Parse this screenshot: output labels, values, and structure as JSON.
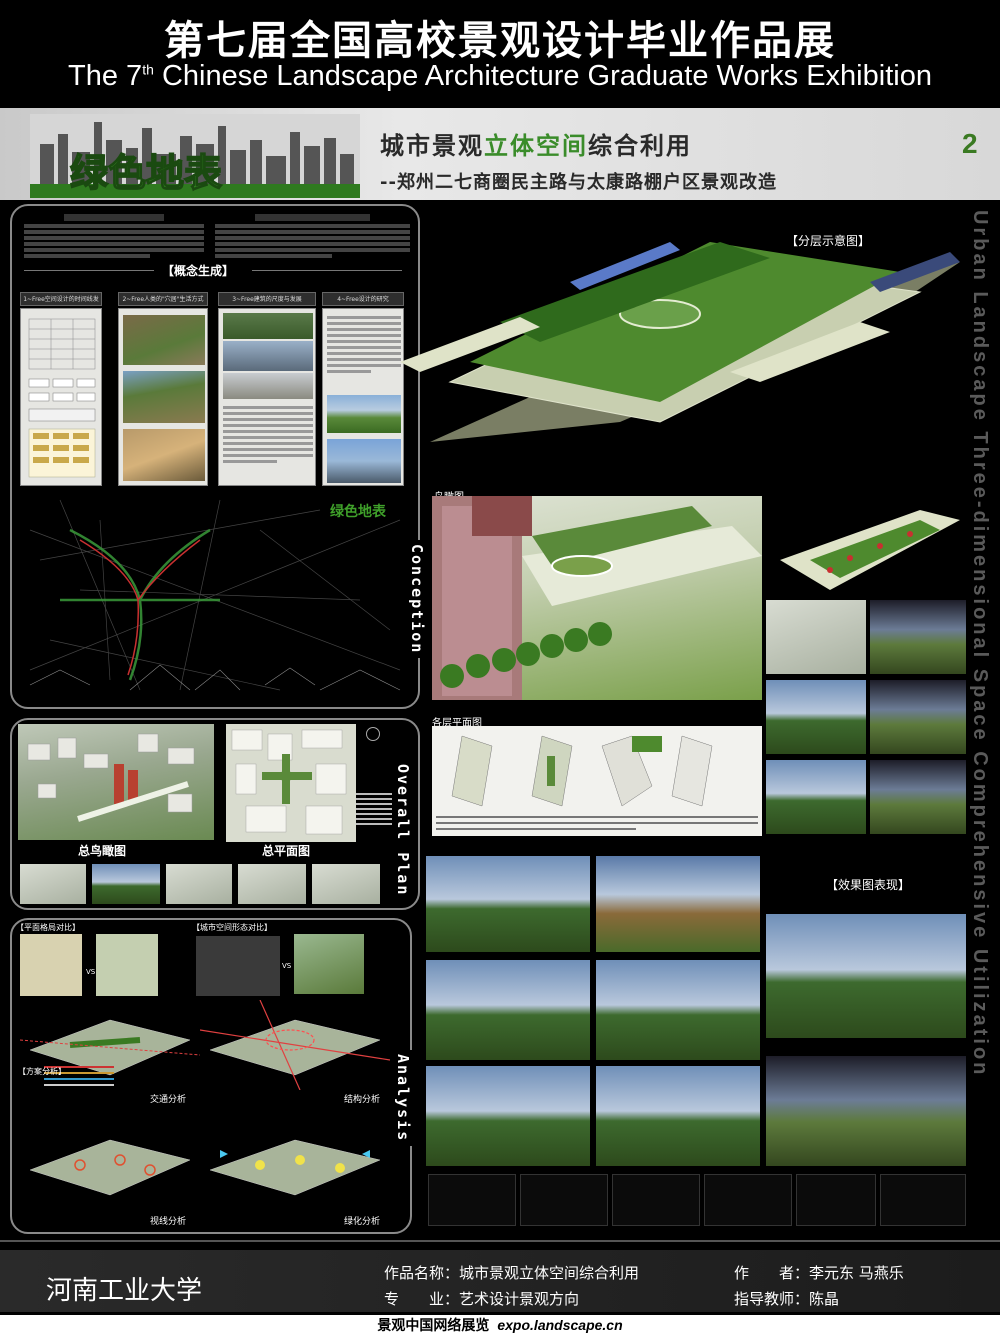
{
  "header": {
    "title_cn": "第七届全国高校景观设计毕业作品展",
    "title_en_pre": "The 7",
    "title_en_sup": "th",
    "title_en_post": " Chinese Landscape Architecture Graduate Works Exhibition"
  },
  "banner": {
    "title_part1": "城市景观",
    "title_part2": "立体空间",
    "title_part3": "综合利用",
    "subtitle": "--郑州二七商圈民主路与太康路棚户区景观改造",
    "page_number": "2",
    "logo_text": "绿色地表"
  },
  "side_text": "Urban Landscape Three-dimensional Space Comprehensive Utilization",
  "sections": {
    "concept": {
      "tab": "Conception",
      "heading": "【概念生成】",
      "columns": [
        "1~Free空间设计的时间线发展",
        "2~Free人类的\"穴居\"生活方式",
        "3~Free建筑的尺度与发展",
        "4~Free设计的研究"
      ]
    },
    "overall": {
      "tab": "Overall Plan",
      "aerial_caption": "总鸟瞰图",
      "plan_caption": "总平面图"
    },
    "analysis": {
      "tab": "Analysis",
      "label_compare1": "【平面格局对比】",
      "label_compare2": "【城市空间形态对比】",
      "label_scheme": "【方案分析】",
      "traffic": "交通分析",
      "structure": "结构分析",
      "node": "视线分析",
      "green": "绿化分析"
    },
    "layers_label": "【分层示意图】",
    "bird_label": "鸟瞰图",
    "floor_label": "各层平面图",
    "effect_label": "【效果图表现】"
  },
  "footer": {
    "school": "河南工业大学",
    "work_label": "作品名称：",
    "work_value": "城市景观立体空间综合利用",
    "author_label": "作　　者：",
    "author_value": "李元东  马燕乐",
    "major_label": "专　　业：",
    "major_value": "艺术设计景观方向",
    "advisor_label": "指导教师：",
    "advisor_value": "陈晶",
    "site_cn": "景观中国网络展览",
    "site_url": "expo.landscape.cn"
  }
}
